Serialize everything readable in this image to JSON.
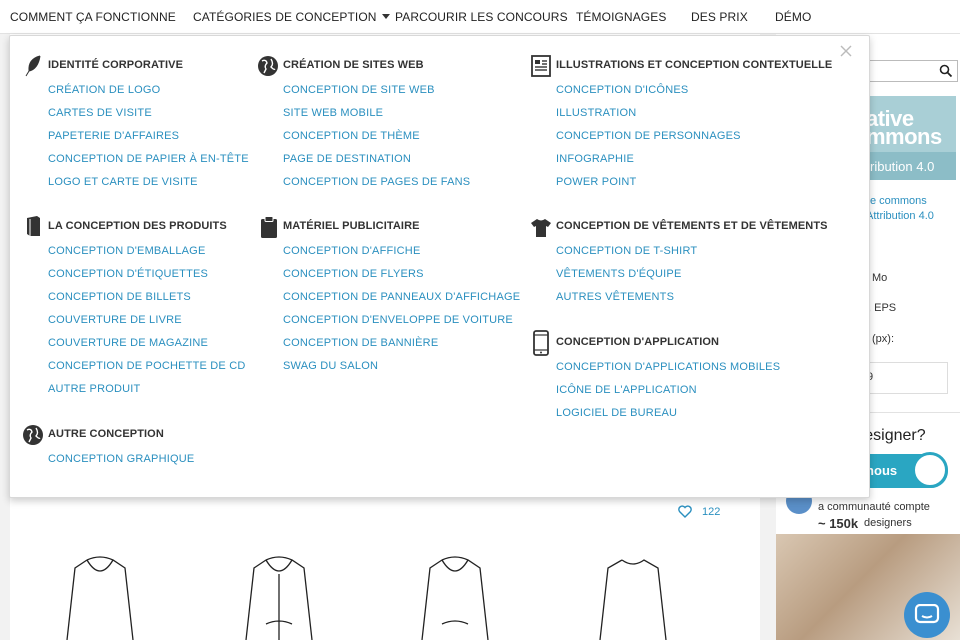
{
  "nav": {
    "items": [
      "Comment ça fonctionne",
      "Catégories de conception",
      "Parcourir les concours",
      "Témoignages",
      "Des prix",
      "Démo"
    ]
  },
  "dropdown": {
    "columns": [
      {
        "groups": [
          {
            "title": "Identité corporative",
            "icon": "feather-icon",
            "links": [
              "Création de logo",
              "Cartes de visite",
              "Papeterie d'affaires",
              "Conception de papier à en-tête",
              "Logo et carte de visite"
            ]
          },
          {
            "title": "La conception des produits",
            "icon": "book-icon",
            "links": [
              "Conception d'emballage",
              "Conception d'étiquettes",
              "Conception de billets",
              "Couverture de livre",
              "Couverture de magazine",
              "Conception de pochette de CD",
              "Autre produit"
            ]
          },
          {
            "title": "Autre conception",
            "icon": "globe-icon",
            "links": [
              "Conception graphique"
            ]
          }
        ]
      },
      {
        "groups": [
          {
            "title": "Création de sites web",
            "icon": "globe-icon",
            "links": [
              "Conception de site web",
              "Site web mobile",
              "Conception de thème",
              "Page de destination",
              "Conception de pages de fans"
            ]
          },
          {
            "title": "Matériel publicitaire",
            "icon": "clipboard-icon",
            "links": [
              "Conception d'affiche",
              "Conception de flyers",
              "Conception de panneaux d'affichage",
              "Conception d'enveloppe de voiture",
              "Conception de bannière",
              "Swag du salon"
            ]
          }
        ]
      },
      {
        "groups": [
          {
            "title": "Illustrations et conception contextuelle",
            "icon": "newspaper-icon",
            "links": [
              "Conception d'icônes",
              "Illustration",
              "Conception de personnages",
              "Infographie",
              "Power Point"
            ]
          },
          {
            "title": "Conception de vêtements et de vêtements",
            "icon": "tshirt-icon",
            "links": [
              "Conception de t-shirt",
              "Vêtements d'équipe",
              "Autres vêtements"
            ]
          },
          {
            "title": "Conception d'application",
            "icon": "smartphone-icon",
            "links": [
              "Conception d'applications mobiles",
              "Icône de l'application",
              "Logiciel de bureau"
            ]
          }
        ]
      }
    ]
  },
  "sidebar": {
    "cc_line1": "ative",
    "cc_line2": "mmons",
    "cc_line3": "ribution 4.0",
    "license_line1": "ive commons",
    "license_line2": "Attribution 4.0",
    "size": "Mo",
    "formats": ", EPS",
    "dimensions_label": "(px):",
    "dimensions_value": "9",
    "promo_title": "n designer?",
    "promo_button": "ez-nous",
    "community_line": "a communauté compte",
    "community_count": "~ 150k",
    "community_suffix": "designers"
  },
  "card": {
    "likes": "122"
  },
  "colors": {
    "link": "#2a8fbf",
    "accent": "#2aa6c2"
  }
}
